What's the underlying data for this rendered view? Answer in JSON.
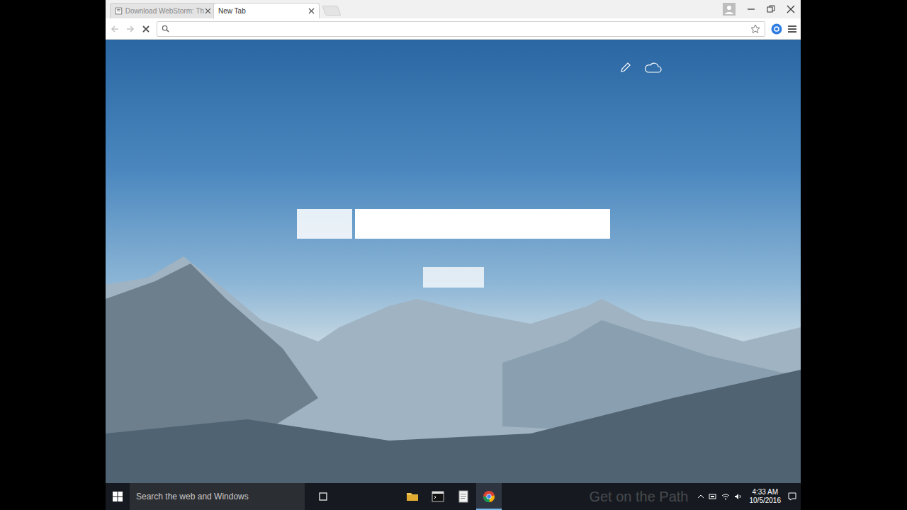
{
  "tabs": [
    {
      "label": "Download WebStorm: Th",
      "selected": false,
      "has_icon": true
    },
    {
      "label": "New Tab",
      "selected": true,
      "has_icon": false
    }
  ],
  "taskbar": {
    "search_placeholder": "Search the web and Windows",
    "apps": [
      {
        "kind": "folder",
        "active": false
      },
      {
        "kind": "terminal",
        "active": false
      },
      {
        "kind": "notes",
        "active": false
      },
      {
        "kind": "chrome",
        "active": true
      }
    ]
  },
  "watermark": "Get on the Path",
  "clock": {
    "time": "4:33 AM",
    "date": "10/5/2016"
  }
}
